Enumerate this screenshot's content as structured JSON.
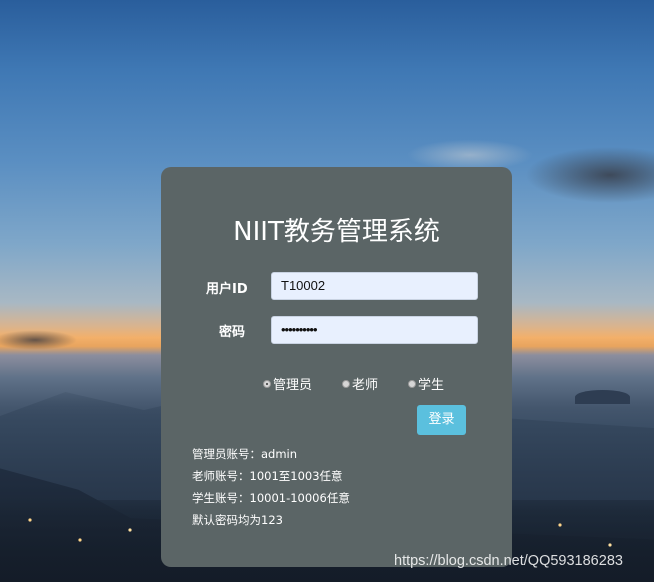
{
  "title": "NIIT教务管理系统",
  "form": {
    "user_id_label": "用户ID",
    "user_id_value": "T10002",
    "password_label": "密码",
    "password_value": "••••••••••",
    "roles": [
      {
        "label": "管理员",
        "checked": true
      },
      {
        "label": "老师",
        "checked": false
      },
      {
        "label": "学生",
        "checked": false
      }
    ],
    "login_label": "登录"
  },
  "info_lines": [
    "管理员账号：admin",
    "老师账号：1001至1003任意",
    "学生账号：10001-10006任意",
    "默认密码均为123"
  ],
  "watermark": "https://blog.csdn.net/QQ593186283",
  "colors": {
    "panel_bg": "#5b6566",
    "login_button": "#5bc0de",
    "input_bg": "#e8f0fe"
  }
}
